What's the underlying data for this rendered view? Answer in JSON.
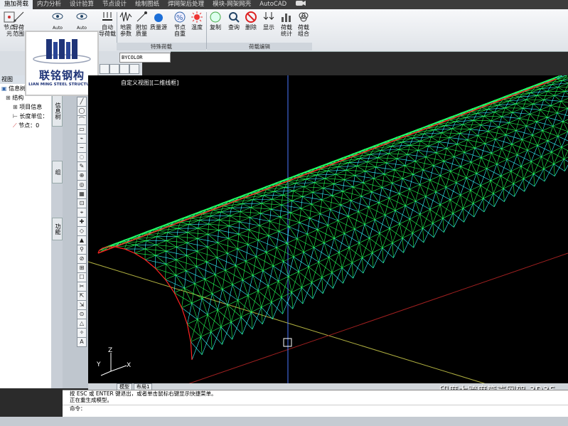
{
  "ribbon_tabs": [
    "施加荷载",
    "内力分析",
    "设计验算",
    "节点设计",
    "绘制图纸",
    "焊网架后处理",
    "模块-网架网壳",
    "AutoCAD"
  ],
  "ribbon_tabs_extra_icon": "video-icon",
  "ribbon_buttons": {
    "node": "节点\n元",
    "guide": "导荷\n范围",
    "auto1": "Auto",
    "auto2": "Auto",
    "auto_guide": "自动\n导荷载",
    "seismic": "地震\n参数",
    "extra_mass": "附加\n质量",
    "mass_source": "质量源",
    "node_weight": "节点\n自重",
    "temperature": "温度",
    "copy": "复制",
    "query": "查询",
    "delete": "删除",
    "display": "显示",
    "load_stats": "荷载\n统计",
    "load_combo": "荷载\n组合"
  },
  "ribbon_groups": {
    "special": "特殊荷载",
    "edit": "荷载编辑"
  },
  "layer_value": "BYCOLOR",
  "logo": {
    "name_cn": "联铭钢构",
    "name_en": "LIAN MING STEEL STRUCTURE"
  },
  "left_panel": {
    "header": "视图",
    "info_tree": "信息树",
    "structure": "结构",
    "project_info": "项目信息",
    "length_unit": "长度单位：",
    "nodes": "节点：0",
    "side_tabs": [
      "信息树",
      "组",
      "功能"
    ]
  },
  "viewport": {
    "label": "自定义视图][二维线框]",
    "ucs_y": "Y",
    "ucs_x": "X",
    "ucs_z": "Z"
  },
  "model_tabs": [
    "模型",
    "布局1"
  ],
  "command_lines": [
    "按 ESC 或 ENTER 键退出，或者单击鼠标右键显示快捷菜单。",
    "正在重生成模型。",
    "命令："
  ],
  "caption": "印度大跨度筒壳网架-3D3S",
  "colors": {
    "mesh_green": "#22ff55",
    "mesh_cyan": "#33ffff",
    "edge_red": "#ff2020",
    "crosshair": "#4a78ff",
    "axis_red": "#a02020",
    "axis_yellow": "#b0b040"
  }
}
